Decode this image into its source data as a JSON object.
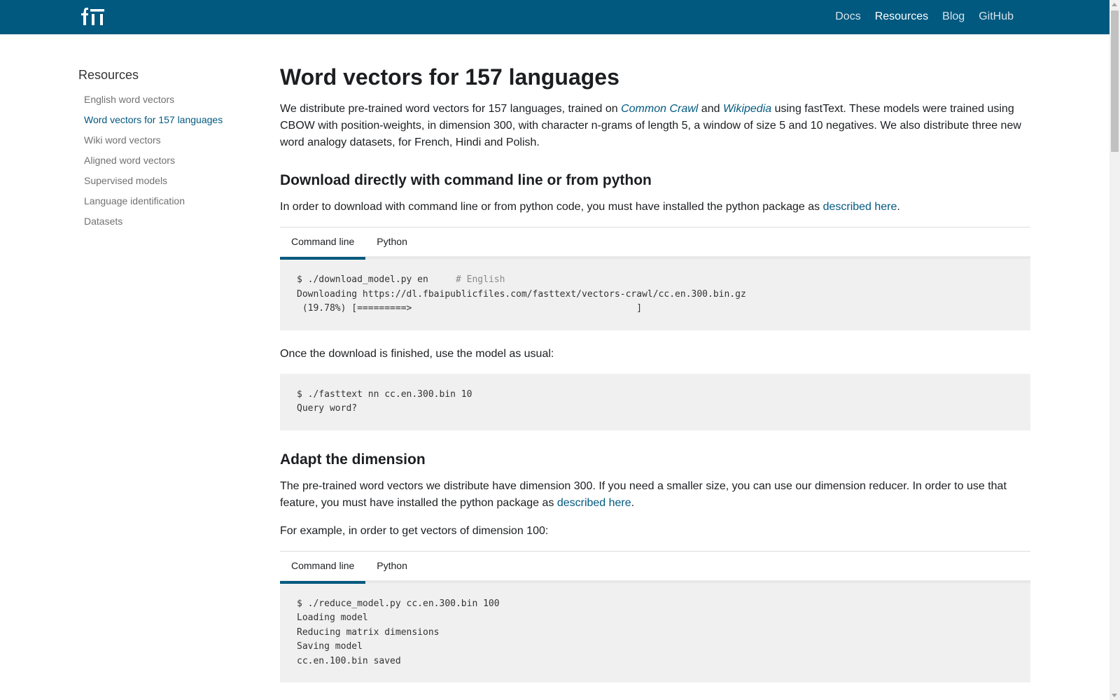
{
  "header": {
    "logo_icon": "fasttext-logo-icon",
    "nav": [
      "Docs",
      "Resources",
      "Blog",
      "GitHub"
    ],
    "active_nav": "Resources",
    "colors": {
      "bar": "#02597f",
      "nav_text": "#d5e3ec",
      "active": "#ffffff"
    }
  },
  "sidebar": {
    "title": "Resources",
    "items": [
      {
        "label": "English word vectors"
      },
      {
        "label": "Word vectors for 157 languages",
        "active": true
      },
      {
        "label": "Wiki word vectors"
      },
      {
        "label": "Aligned word vectors"
      },
      {
        "label": "Supervised models"
      },
      {
        "label": "Language identification"
      },
      {
        "label": "Datasets"
      }
    ]
  },
  "main": {
    "title": "Word vectors for 157 languages",
    "intro": {
      "part1": "We distribute pre-trained word vectors for 157 languages, trained on ",
      "link1": "Common Crawl",
      "part2": " and ",
      "link2": "Wikipedia",
      "part3": " using fastText. These models were trained using CBOW with position-weights, in dimension 300, with character n-grams of length 5, a window of size 5 and 10 negatives. We also distribute three new word analogy datasets, for French, Hindi and Polish."
    },
    "section1": {
      "heading": "Download directly with command line or from python",
      "text_before": "In order to download with command line or from python code, you must have installed the python package as ",
      "link": "described here",
      "text_after": ".",
      "tabs": [
        "Command line",
        "Python"
      ],
      "code_prefix": "$ ./download_model.py en     ",
      "code_comment": "# English",
      "code_rest": "\nDownloading https://dl.fbaipublicfiles.com/fasttext/vectors-crawl/cc.en.300.bin.gz\n (19.78%) [=========>                                         ]",
      "after_text": "Once the download is finished, use the model as usual:",
      "code2": "$ ./fasttext nn cc.en.300.bin 10\nQuery word?"
    },
    "section2": {
      "heading": "Adapt the dimension",
      "text_before": "The pre-trained word vectors we distribute have dimension 300. If you need a smaller size, you can use our dimension reducer. In order to use that feature, you must have installed the python package as ",
      "link": "described here",
      "text_after": ".",
      "example_text": "For example, in order to get vectors of dimension 100:",
      "tabs": [
        "Command line",
        "Python"
      ],
      "code": "$ ./reduce_model.py cc.en.300.bin 100\nLoading model\nReducing matrix dimensions\nSaving model\ncc.en.100.bin saved"
    }
  }
}
